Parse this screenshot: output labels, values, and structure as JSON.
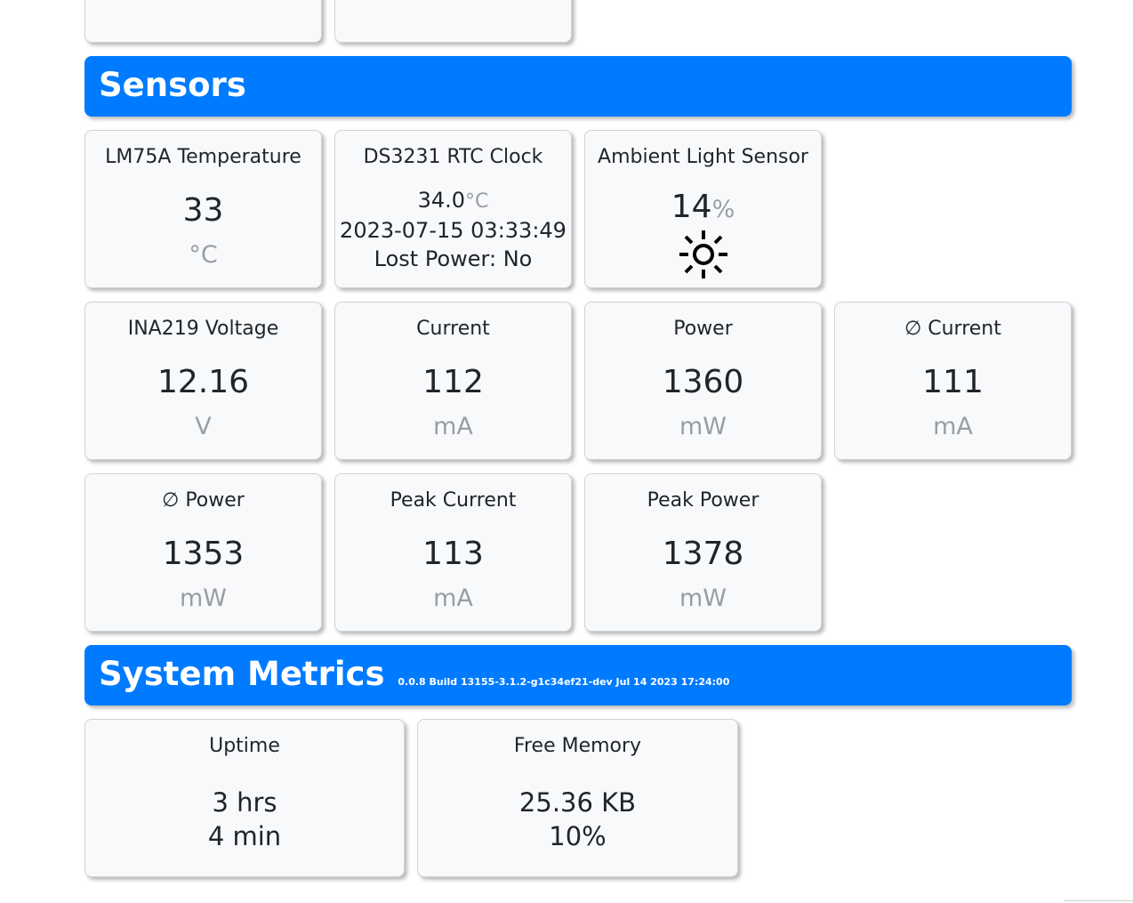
{
  "sensors_header": {
    "title": "Sensors"
  },
  "lm75a": {
    "title": "LM75A Temperature",
    "value": "33",
    "unit": "°C"
  },
  "rtc": {
    "title": "DS3231 RTC Clock",
    "temp_value": "34.0",
    "temp_unit": "°C",
    "datetime": "2023-07-15 03:33:49",
    "lost_power": "Lost Power: No"
  },
  "ambient": {
    "title": "Ambient Light Sensor",
    "value": "14",
    "unit": "%",
    "icon": "sun-icon"
  },
  "ina219_voltage": {
    "title": "INA219 Voltage",
    "value": "12.16",
    "unit": "V"
  },
  "current": {
    "title": "Current",
    "value": "112",
    "unit": "mA"
  },
  "power": {
    "title": "Power",
    "value": "1360",
    "unit": "mW"
  },
  "avg_current": {
    "title": "∅ Current",
    "value": "111",
    "unit": "mA"
  },
  "avg_power": {
    "title": "∅ Power",
    "value": "1353",
    "unit": "mW"
  },
  "peak_current": {
    "title": "Peak Current",
    "value": "113",
    "unit": "mA"
  },
  "peak_power": {
    "title": "Peak Power",
    "value": "1378",
    "unit": "mW"
  },
  "system_header": {
    "title": "System Metrics",
    "build": "0.0.8 Build 13155-3.1.2-g1c34ef21-dev Jul 14 2023 17:24:00"
  },
  "uptime": {
    "title": "Uptime",
    "line1": "3 hrs",
    "line2": "4 min"
  },
  "free_memory": {
    "title": "Free Memory",
    "line1": "25.36 KB",
    "line2": "10%"
  },
  "colors": {
    "banner": "#007bff",
    "card_bg": "#f8f9fa",
    "unit_gray": "#9a9da1"
  }
}
